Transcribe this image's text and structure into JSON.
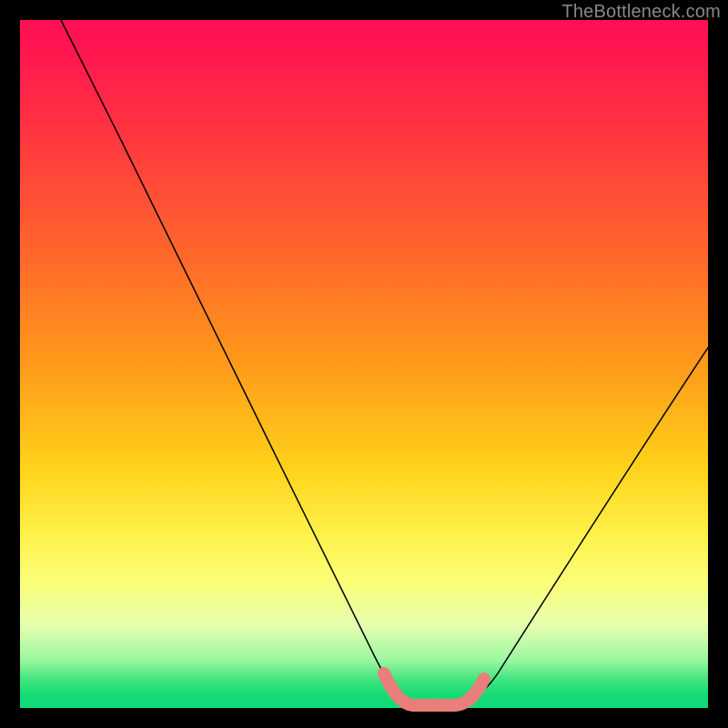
{
  "watermark": "TheBottleneck.com",
  "colors": {
    "curve": "#000000",
    "highlight": "#e97e7b",
    "frame": "#000000"
  },
  "chart_data": {
    "type": "line",
    "title": "",
    "xlabel": "",
    "ylabel": "",
    "xlim": [
      0,
      100
    ],
    "ylim": [
      0,
      100
    ],
    "grid": false,
    "legend": false,
    "series": [
      {
        "name": "bottleneck-curve",
        "x": [
          6,
          10,
          14,
          18,
          20,
          25,
          30,
          35,
          40,
          45,
          50,
          52,
          54,
          56,
          58,
          60,
          62,
          64,
          68,
          72,
          76,
          80,
          84,
          88,
          92,
          96,
          100
        ],
        "y": [
          100,
          92,
          85,
          78,
          74,
          64,
          54,
          44,
          34,
          24,
          14,
          10,
          6,
          4,
          2,
          1,
          1,
          2,
          4,
          9,
          15,
          22,
          30,
          38,
          46,
          54,
          60
        ]
      },
      {
        "name": "highlight-minimum",
        "x": [
          52,
          54,
          56,
          58,
          60,
          62,
          64
        ],
        "y": [
          5,
          3,
          2,
          1,
          1,
          2,
          3
        ]
      }
    ],
    "annotations": []
  }
}
